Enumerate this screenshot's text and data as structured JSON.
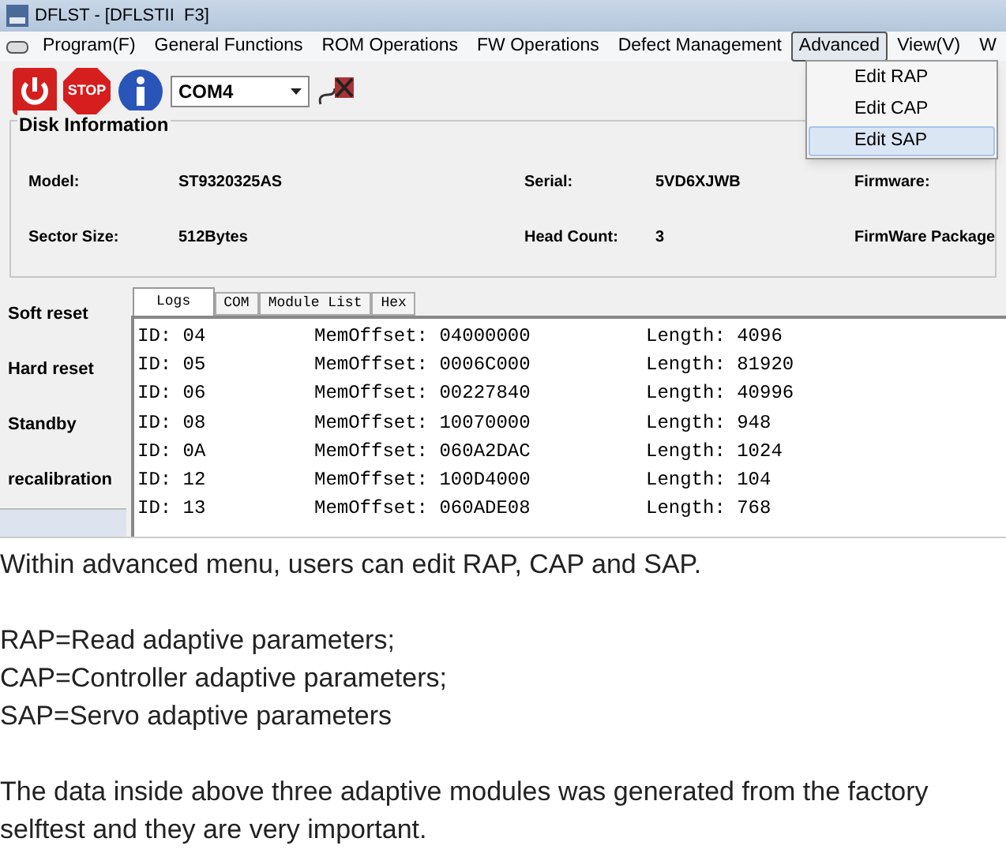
{
  "window": {
    "title": "DFLST - [DFLSTII  F3]"
  },
  "menu": [
    {
      "label": "Program(F)",
      "selected": false
    },
    {
      "label": "General Functions",
      "selected": false
    },
    {
      "label": "ROM Operations",
      "selected": false
    },
    {
      "label": "FW Operations",
      "selected": false
    },
    {
      "label": "Defect Management",
      "selected": false
    },
    {
      "label": "Advanced",
      "selected": true
    },
    {
      "label": "View(V)",
      "selected": false
    },
    {
      "label": "W",
      "selected": false
    }
  ],
  "dropdown": [
    {
      "label": "Edit RAP",
      "selected": false
    },
    {
      "label": "Edit CAP",
      "selected": false
    },
    {
      "label": "Edit SAP",
      "selected": true
    }
  ],
  "toolbar": {
    "stop_label": "STOP",
    "port": "COM4"
  },
  "disk_info": {
    "title": "Disk Information",
    "rows": [
      [
        {
          "label": "Model:",
          "value": "ST9320325AS"
        },
        {
          "label": "Serial:",
          "value": "5VD6XJWB"
        },
        {
          "label": "Firmware:"
        }
      ],
      [
        {
          "label": "Sector Size:",
          "value": "512Bytes"
        },
        {
          "label": "Head Count:",
          "value": "3"
        },
        {
          "label": "FirmWare Package"
        }
      ]
    ]
  },
  "side_buttons": [
    "Soft reset",
    "Hard reset",
    "Standby",
    "recalibration"
  ],
  "tabs": [
    {
      "label": "Logs",
      "selected": true
    },
    {
      "label": "COM",
      "selected": false
    },
    {
      "label": "Module List",
      "selected": false
    },
    {
      "label": "Hex",
      "selected": false
    }
  ],
  "log": [
    {
      "id": "ID: 04",
      "offset": "MemOffset: 04000000",
      "length": "Length: 4096"
    },
    {
      "id": "ID: 05",
      "offset": "MemOffset: 0006C000",
      "length": "Length: 81920"
    },
    {
      "id": "ID: 06",
      "offset": "MemOffset: 00227840",
      "length": "Length: 40996"
    },
    {
      "id": "ID: 08",
      "offset": "MemOffset: 10070000",
      "length": "Length: 948"
    },
    {
      "id": "ID: 0A",
      "offset": "MemOffset: 060A2DAC",
      "length": "Length: 1024"
    },
    {
      "id": "ID: 12",
      "offset": "MemOffset: 100D4000",
      "length": "Length: 104"
    },
    {
      "id": "ID: 13",
      "offset": "MemOffset: 060ADE08",
      "length": "Length: 768"
    }
  ],
  "text": [
    "Within advanced menu, users can edit RAP, CAP and SAP.",
    "RAP=Read adaptive parameters;\nCAP=Controller adaptive parameters;\nSAP=Servo adaptive parameters",
    "The data inside above three adaptive modules was generated from the factory selftest and they are very important."
  ]
}
